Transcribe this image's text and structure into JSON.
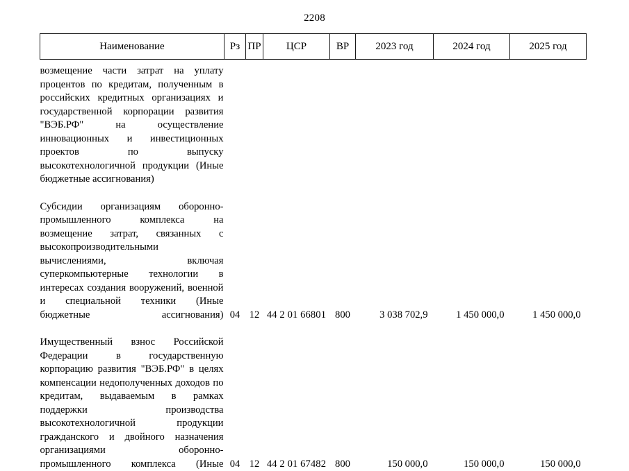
{
  "page": {
    "number": "2208"
  },
  "table": {
    "headers": {
      "name": "Наименование",
      "rz": "Рз",
      "pr": "ПР",
      "csr": "ЦСР",
      "vr": "ВР",
      "year1": "2023 год",
      "year2": "2024 год",
      "year3": "2025 год"
    },
    "rows": [
      {
        "name": "возмещение части затрат на уплату процентов по кредитам, полученным в российских кредитных организациях и государственной корпорации развития \"ВЭБ.РФ\" на осуществление инновационных и инвестиционных проектов по выпуску высокотехнологичной продукции (Иные бюджетные ассигнования)",
        "rz": "",
        "pr": "",
        "csr": "",
        "vr": "",
        "year1": "",
        "year2": "",
        "year3": ""
      },
      {
        "name": "Субсидии организациям оборонно-промышленного комплекса на возмещение затрат, связанных с высокопроизводительными вычислениями, включая суперкомпьютерные технологии в интересах создания вооружений, военной и специальной техники (Иные бюджетные ассигнования)",
        "rz": "04",
        "pr": "12",
        "csr": "44 2 01 66801",
        "vr": "800",
        "year1": "3 038 702,9",
        "year2": "1 450 000,0",
        "year3": "1 450 000,0"
      },
      {
        "name": "Имущественный взнос Российской Федерации в государственную корпорацию развития \"ВЭБ.РФ\" в целях компенсации недополученных доходов по кредитам, выдаваемым в рамках поддержки производства высокотехнологичной продукции гражданского и двойного назначения организациями оборонно-промышленного комплекса (Иные",
        "rz": "04",
        "pr": "12",
        "csr": "44 2 01 67482",
        "vr": "800",
        "year1": "150 000,0",
        "year2": "150 000,0",
        "year3": "150 000,0"
      }
    ]
  }
}
